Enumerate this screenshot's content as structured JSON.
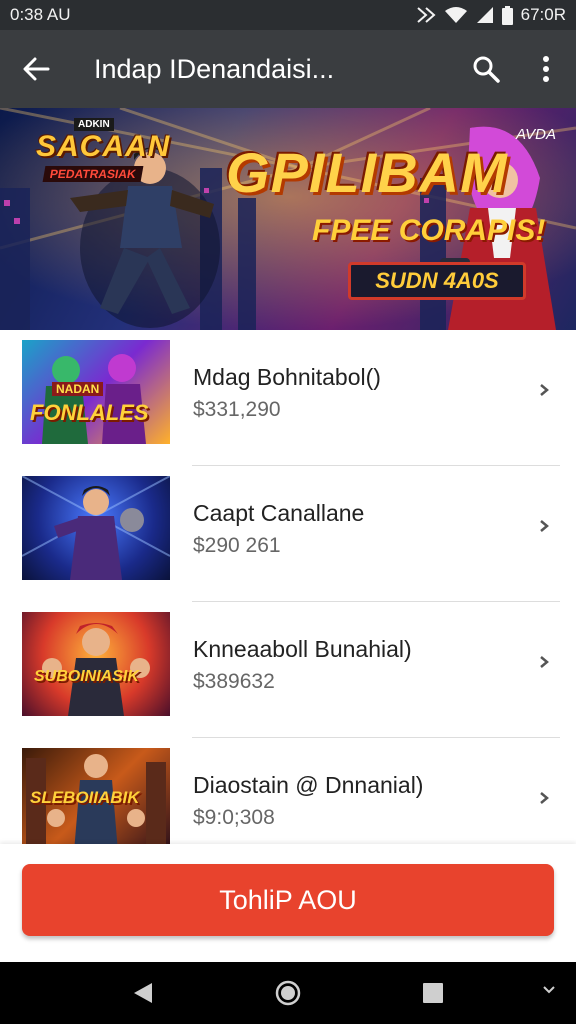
{
  "status_bar": {
    "time": "0:38 AU",
    "clock_right": "67:0R",
    "icons": [
      "nfc-icon",
      "wifi-icon",
      "signal-icon",
      "battery-icon"
    ]
  },
  "app_bar": {
    "title": "Indap IDenandaisi...",
    "icons": [
      "back-arrow-icon",
      "search-icon",
      "more-vert-icon"
    ]
  },
  "banner": {
    "corner_label": "AVDA",
    "left_badge": "ADKIN",
    "left_title": "SACAAN",
    "left_subtitle": "PEDATRASIAK",
    "title": "GPILIBAM",
    "subtitle": "FPEE CORAPIS!",
    "cta": "SUDN 4A0S"
  },
  "products": [
    {
      "name": "Mdag Bohnitabol()",
      "price": "$331,290",
      "thumb_text": "FONLALES",
      "thumb_badge": "NADAN"
    },
    {
      "name": "Caapt Canallane",
      "price": "$290 261",
      "thumb_text": "",
      "thumb_badge": ""
    },
    {
      "name": "Knneaaboll Bunahial)",
      "price": "$389632",
      "thumb_text": "SUBOINIASIK",
      "thumb_badge": ""
    },
    {
      "name": "Diaostain @ Dnnanial)",
      "price": "$9:0;308",
      "thumb_text": "SLEBOIIABIK",
      "thumb_badge": ""
    }
  ],
  "action_button": {
    "label": "TohliP AOU"
  },
  "nav_bar": {
    "icons": [
      "back-triangle-icon",
      "home-circle-icon",
      "recents-square-icon",
      "chevron-down-icon"
    ]
  },
  "colors": {
    "accent": "#e8432d",
    "app_bar": "#3a3d40",
    "status_bar": "#2b2e31"
  }
}
